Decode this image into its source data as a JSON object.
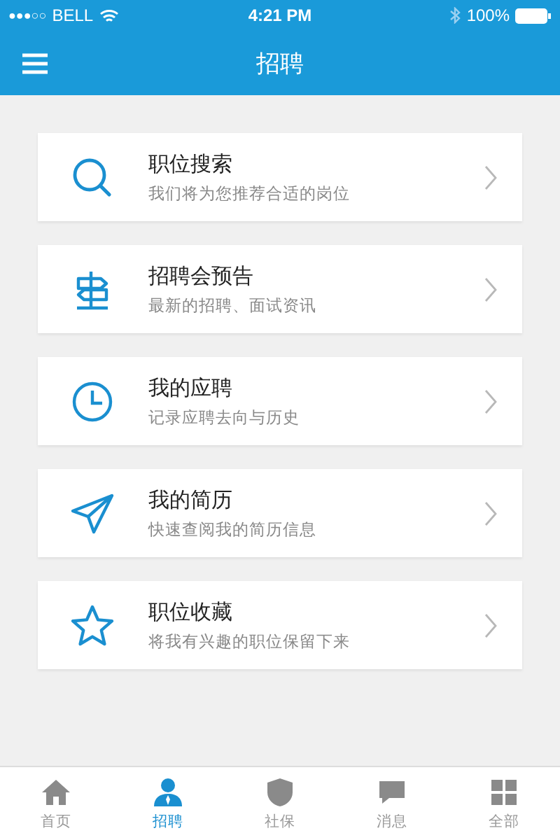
{
  "status_bar": {
    "signal": "●●●○○",
    "carrier": "BELL",
    "time": "4:21 PM",
    "battery": "100%"
  },
  "nav_bar": {
    "title": "招聘"
  },
  "items": [
    {
      "kind": "search",
      "title": "职位搜索",
      "subtitle": "我们将为您推荐合适的岗位"
    },
    {
      "kind": "signpost",
      "title": "招聘会预告",
      "subtitle": "最新的招聘、面试资讯"
    },
    {
      "kind": "clock",
      "title": "我的应聘",
      "subtitle": "记录应聘去向与历史"
    },
    {
      "kind": "plane",
      "title": "我的简历",
      "subtitle": "快速查阅我的简历信息"
    },
    {
      "kind": "star",
      "title": "职位收藏",
      "subtitle": "将我有兴趣的职位保留下来"
    }
  ],
  "tab_bar": [
    {
      "kind": "home",
      "label": "首页",
      "selected": false
    },
    {
      "kind": "person",
      "label": "招聘",
      "selected": true
    },
    {
      "kind": "shield",
      "label": "社保",
      "selected": false
    },
    {
      "kind": "chat",
      "label": "消息",
      "selected": false
    },
    {
      "kind": "grid",
      "label": "全部",
      "selected": false
    }
  ]
}
